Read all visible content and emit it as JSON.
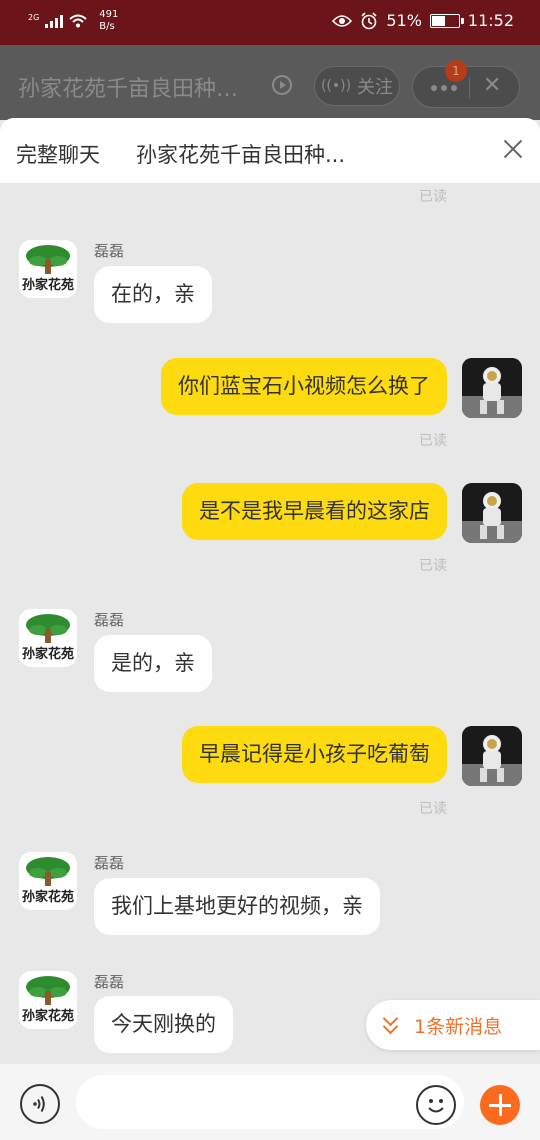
{
  "status_bar": {
    "network": "2G",
    "speed_value": "491",
    "speed_unit": "B/s",
    "battery_text": "51%",
    "battery_level": 0.51,
    "time": "11:52"
  },
  "live_header": {
    "title": "孙家花苑千亩良田种…",
    "follow_label": "关注",
    "notification_count": "1"
  },
  "panel": {
    "tab_label": "完整聊天",
    "title": "孙家花苑千亩良田种..."
  },
  "shop": {
    "avatar_text": "孙家花苑",
    "sender_name": "磊磊"
  },
  "read_label": "已读",
  "messages": [
    {
      "from": "shop",
      "text": "在的，亲"
    },
    {
      "from": "me",
      "text": "你们蓝宝石小视频怎么换了"
    },
    {
      "from": "me",
      "text": "是不是我早晨看的这家店"
    },
    {
      "from": "shop",
      "text": "是的，亲"
    },
    {
      "from": "me",
      "text": "早晨记得是小孩子吃葡萄"
    },
    {
      "from": "shop",
      "text": "我们上基地更好的视频，亲"
    },
    {
      "from": "shop",
      "text": "今天刚换的"
    }
  ],
  "new_message_label": "1条新消息",
  "colors": {
    "status_bar": "#6b1419",
    "outgoing_bubble": "#fddb0f",
    "accent": "#f2712a",
    "plus_button": "#fb6b1e"
  }
}
